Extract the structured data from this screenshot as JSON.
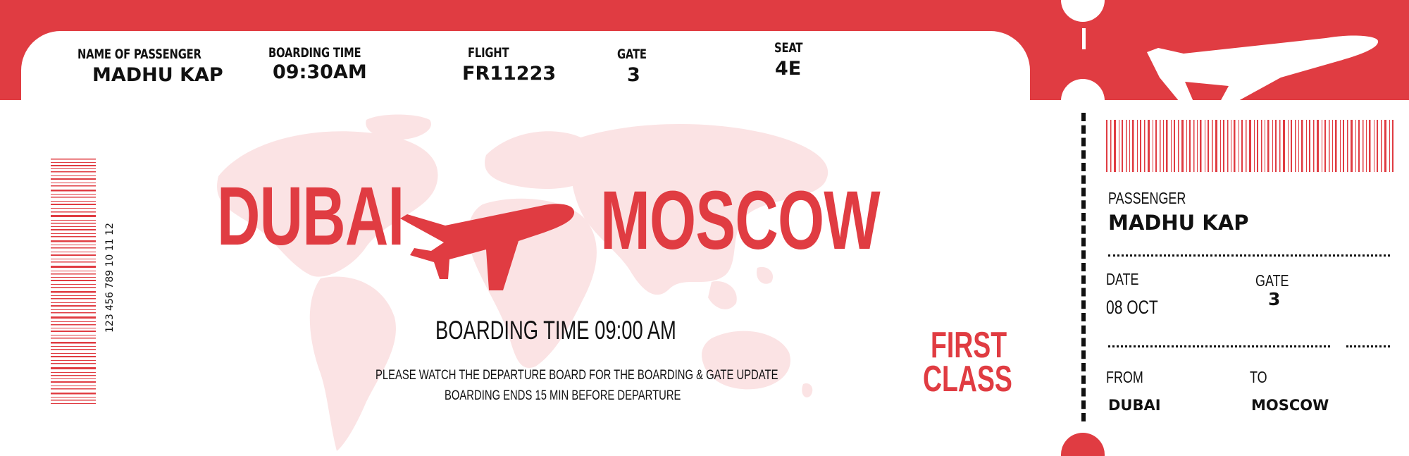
{
  "ticket": {
    "accent_color": "#e03c42",
    "header": {
      "passenger_label": "NAME OF PASSENGER",
      "passenger_value": "MADHU KAP",
      "boarding_time_label": "BOARDING TIME",
      "boarding_time_value": "09:30AM",
      "flight_label": "FLIGHT",
      "flight_value": "FR11223",
      "gate_label": "GATE",
      "gate_value": "3",
      "seat_label": "SEAT",
      "seat_value": "4E"
    },
    "main": {
      "origin": "DUBAI",
      "destination": "MOSCOW",
      "boarding_time_line": "BOARDING TIME 09:00 AM",
      "notice_1": "PLEASE WATCH THE DEPARTURE BOARD FOR THE BOARDING & GATE UPDATE",
      "notice_2": "BOARDING ENDS 15 MIN BEFORE DEPARTURE",
      "class_line_1": "FIRST",
      "class_line_2": "CLASS",
      "barcode_number": "123 456 789 10 11 12",
      "icons": [
        "airplane-icon",
        "world-map",
        "barcode"
      ]
    },
    "stub": {
      "passenger_label": "PASSENGER",
      "passenger_value": "MADHU KAP",
      "date_label": "DATE",
      "date_value": "08 OCT",
      "gate_label": "GATE",
      "gate_value": "3",
      "from_label": "FROM",
      "from_value": "DUBAI",
      "to_label": "TO",
      "to_value": "MOSCOW",
      "icons": [
        "airplane-icon",
        "barcode"
      ]
    }
  }
}
